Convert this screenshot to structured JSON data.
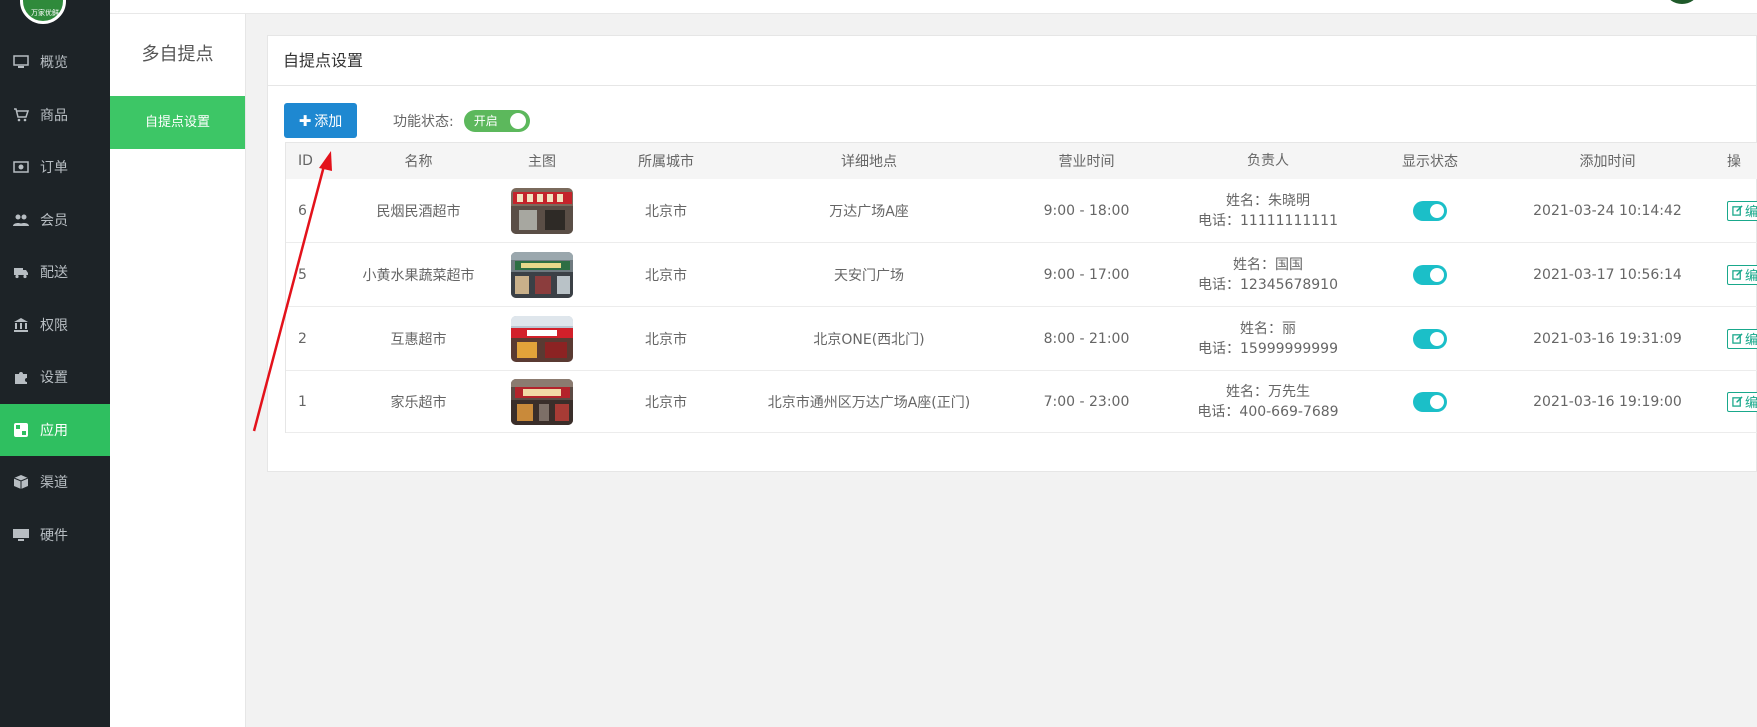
{
  "app": {
    "logo_text": "万家优鲜",
    "accent_color": "#2fbf60",
    "sidebar_bg": "#1d2327"
  },
  "sidebar": {
    "items": [
      {
        "label": "概览",
        "icon": "monitor-icon",
        "active": false
      },
      {
        "label": "商品",
        "icon": "cart-icon",
        "active": false
      },
      {
        "label": "订单",
        "icon": "money-icon",
        "active": false
      },
      {
        "label": "会员",
        "icon": "users-icon",
        "active": false
      },
      {
        "label": "配送",
        "icon": "truck-icon",
        "active": false
      },
      {
        "label": "权限",
        "icon": "bank-icon",
        "active": false
      },
      {
        "label": "设置",
        "icon": "puzzle-icon",
        "active": false
      },
      {
        "label": "应用",
        "icon": "apps-icon",
        "active": true
      },
      {
        "label": "渠道",
        "icon": "cube-icon",
        "active": false
      },
      {
        "label": "硬件",
        "icon": "desktop-icon",
        "active": false
      }
    ]
  },
  "subnav": {
    "title": "多自提点",
    "items": [
      {
        "label": "自提点设置",
        "active": true
      }
    ]
  },
  "card": {
    "title": "自提点设置"
  },
  "toolbar": {
    "add_label": "添加",
    "status_label": "功能状态:",
    "switch_label": "开启",
    "switch_on": true
  },
  "table": {
    "columns": [
      "ID",
      "名称",
      "主图",
      "所属城市",
      "详细地点",
      "营业时间",
      "负责人",
      "显示状态",
      "添加时间",
      "操"
    ],
    "rows": [
      {
        "id": "6",
        "name": "民烟民酒超市",
        "city": "北京市",
        "address": "万达广场A座",
        "hours": "9:00 - 18:00",
        "owner_name": "姓名：朱晓明",
        "owner_phone": "电话：11111111111",
        "visible": true,
        "added": "2021-03-24 10:14:42",
        "edit": "编辑"
      },
      {
        "id": "5",
        "name": "小黄水果蔬菜超市",
        "city": "北京市",
        "address": "天安门广场",
        "hours": "9:00 - 17:00",
        "owner_name": "姓名：国国",
        "owner_phone": "电话：12345678910",
        "visible": true,
        "added": "2021-03-17 10:56:14",
        "edit": "编辑"
      },
      {
        "id": "2",
        "name": "互惠超市",
        "city": "北京市",
        "address": "北京ONE(西北门)",
        "hours": "8:00 - 21:00",
        "owner_name": "姓名：丽",
        "owner_phone": "电话：15999999999",
        "visible": true,
        "added": "2021-03-16 19:31:09",
        "edit": "编辑"
      },
      {
        "id": "1",
        "name": "家乐超市",
        "city": "北京市",
        "address": "北京市通州区万达广场A座(正门)",
        "hours": "7:00 - 23:00",
        "owner_name": "姓名：万先生",
        "owner_phone": "电话：400-669-7689",
        "visible": true,
        "added": "2021-03-16 19:19:00",
        "edit": "编辑"
      }
    ]
  }
}
